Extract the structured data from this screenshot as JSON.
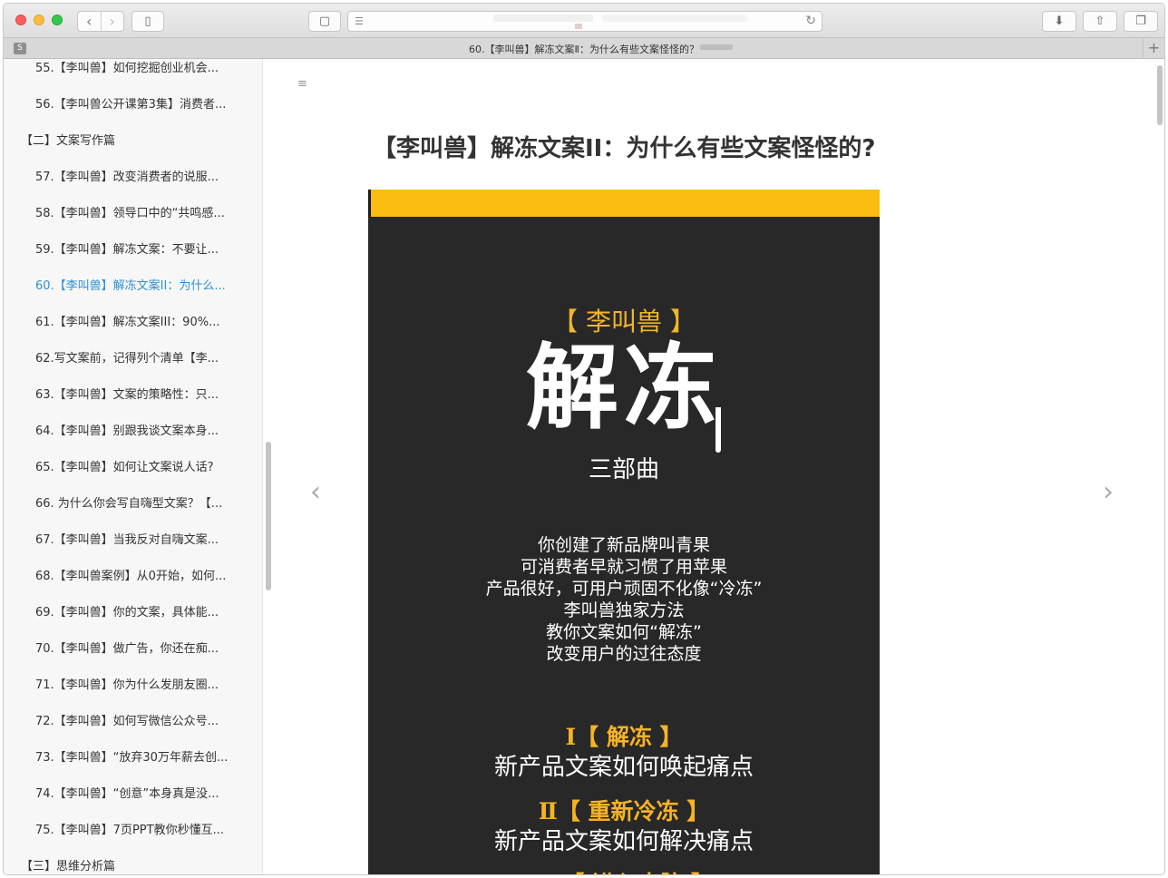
{
  "browser": {
    "tab_badge": "S",
    "tab_title": "60.【李叫兽】解冻文案Ⅱ：为什么有些文案怪怪的？",
    "reader_icon": "reader-icon",
    "reload_icon": "reload-icon"
  },
  "sidebar": {
    "items": [
      {
        "label": "55.【李叫兽】如何挖掘创业机会...",
        "type": "item"
      },
      {
        "label": "56.【李叫兽公开课第3集】消费者...",
        "type": "item"
      },
      {
        "label": "【二】文案写作篇",
        "type": "section"
      },
      {
        "label": "57.【李叫兽】改变消费者的说服...",
        "type": "item"
      },
      {
        "label": "58.【李叫兽】领导口中的“共鸣感...",
        "type": "item"
      },
      {
        "label": "59.【李叫兽】解冻文案：不要让...",
        "type": "item"
      },
      {
        "label": "60.【李叫兽】解冻文案II：为什么...",
        "type": "active"
      },
      {
        "label": "61.【李叫兽】解冻文案III：90%...",
        "type": "item"
      },
      {
        "label": "62.写文案前，记得列个清单【李...",
        "type": "item"
      },
      {
        "label": "63.【李叫兽】文案的策略性：只...",
        "type": "item"
      },
      {
        "label": "64.【李叫兽】别跟我谈文案本身...",
        "type": "item"
      },
      {
        "label": "65.【李叫兽】如何让文案说人话?",
        "type": "item"
      },
      {
        "label": "66. 为什么你会写自嗨型文案？【...",
        "type": "item"
      },
      {
        "label": "67.【李叫兽】当我反对自嗨文案...",
        "type": "item"
      },
      {
        "label": "68.【李叫兽案例】从0开始，如何...",
        "type": "item"
      },
      {
        "label": "69.【李叫兽】你的文案，具体能...",
        "type": "item"
      },
      {
        "label": "70.【李叫兽】做广告，你还在痴...",
        "type": "item"
      },
      {
        "label": "71.【李叫兽】你为什么发朋友圈...",
        "type": "item"
      },
      {
        "label": "72.【李叫兽】如何写微信公众号...",
        "type": "item"
      },
      {
        "label": "73.【李叫兽】“放弃30万年薪去创...",
        "type": "item"
      },
      {
        "label": "74.【李叫兽】“创意”本身真是没...",
        "type": "item"
      },
      {
        "label": "75.【李叫兽】7页PPT教你秒懂互...",
        "type": "item"
      },
      {
        "label": "【三】思维分析篇",
        "type": "section"
      }
    ]
  },
  "article": {
    "title": "【李叫兽】解冻文案II：为什么有些文案怪怪的?",
    "prev_arrow": "‹",
    "next_arrow": "›"
  },
  "poster": {
    "brand": "【 李叫兽 】",
    "main": "解冻",
    "sub": "三部曲",
    "body": [
      "你创建了新品牌叫青果",
      "可消费者早就习惯了用苹果",
      "产品很好，可用户顽固不化像“冷冻”",
      "李叫兽独家方法",
      "教你文案如何“解冻”",
      "改变用户的过往态度"
    ],
    "sections": [
      {
        "title": "Ⅰ【 解冻 】",
        "desc": "新产品文案如何唤起痛点"
      },
      {
        "title": "Ⅱ【 重新冷冻 】",
        "desc": "新产品文案如何解决痛点"
      },
      {
        "title": "Ⅲ【 进入大脑 】",
        "desc": ""
      }
    ],
    "accent_color": "#fbbd10"
  }
}
